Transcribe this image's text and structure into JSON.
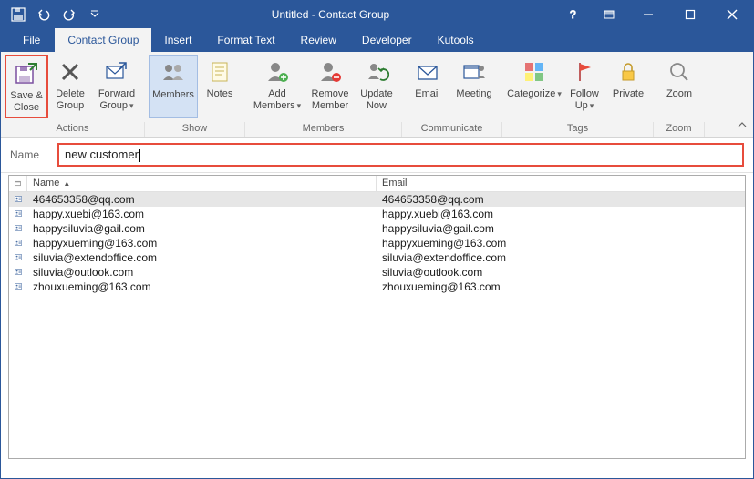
{
  "window": {
    "title": "Untitled -  Contact Group"
  },
  "tabs": {
    "file": "File",
    "contact_group": "Contact Group",
    "insert": "Insert",
    "format_text": "Format Text",
    "review": "Review",
    "developer": "Developer",
    "kutools": "Kutools"
  },
  "ribbon": {
    "groups": {
      "actions": {
        "label": "Actions",
        "save_close": "Save & Close",
        "delete_group": "Delete Group",
        "forward_group": "Forward Group"
      },
      "show": {
        "label": "Show",
        "members": "Members",
        "notes": "Notes"
      },
      "members": {
        "label": "Members",
        "add_members": "Add Members",
        "remove_member": "Remove Member",
        "update_now": "Update Now"
      },
      "communicate": {
        "label": "Communicate",
        "email": "Email",
        "meeting": "Meeting"
      },
      "tags": {
        "label": "Tags",
        "categorize": "Categorize",
        "follow_up": "Follow Up",
        "private": "Private"
      },
      "zoom": {
        "label": "Zoom",
        "zoom": "Zoom"
      }
    }
  },
  "name_field": {
    "label": "Name",
    "value": "new customer"
  },
  "columns": {
    "name": "Name",
    "email": "Email"
  },
  "members_list": [
    {
      "name": "464653358@qq.com",
      "email": "464653358@qq.com",
      "selected": true
    },
    {
      "name": "happy.xuebi@163.com",
      "email": "happy.xuebi@163.com",
      "selected": false
    },
    {
      "name": "happysiluvia@gail.com",
      "email": "happysiluvia@gail.com",
      "selected": false
    },
    {
      "name": "happyxueming@163.com",
      "email": "happyxueming@163.com",
      "selected": false
    },
    {
      "name": "siluvia@extendoffice.com",
      "email": "siluvia@extendoffice.com",
      "selected": false
    },
    {
      "name": "siluvia@outlook.com",
      "email": "siluvia@outlook.com",
      "selected": false
    },
    {
      "name": "zhouxueming@163.com",
      "email": "zhouxueming@163.com",
      "selected": false
    }
  ]
}
